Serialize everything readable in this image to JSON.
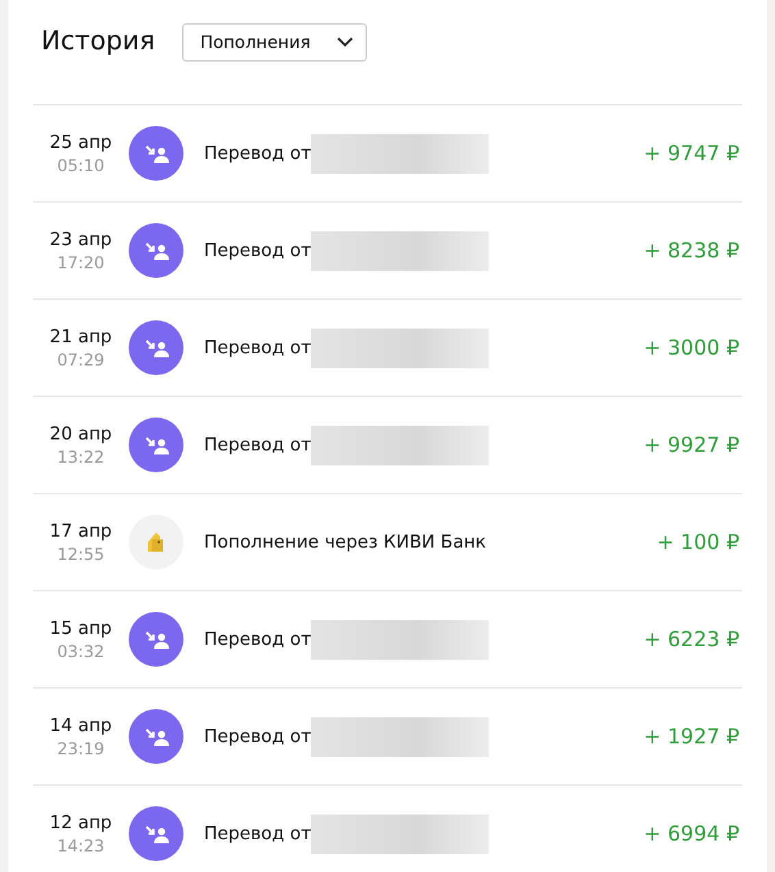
{
  "title": "История",
  "filter": {
    "value": "Пополнения"
  },
  "operations": [
    {
      "date": "25 апр",
      "time": "05:10",
      "kind": "transfer",
      "description": "Перевод от",
      "redacted": true,
      "amount": "+ 9747 ₽"
    },
    {
      "date": "23 апр",
      "time": "17:20",
      "kind": "transfer",
      "description": "Перевод от",
      "redacted": true,
      "amount": "+ 8238 ₽"
    },
    {
      "date": "21 апр",
      "time": "07:29",
      "kind": "transfer",
      "description": "Перевод от",
      "redacted": true,
      "amount": "+ 3000 ₽"
    },
    {
      "date": "20 апр",
      "time": "13:22",
      "kind": "transfer",
      "description": "Перевод от",
      "redacted": true,
      "amount": "+ 9927 ₽"
    },
    {
      "date": "17 апр",
      "time": "12:55",
      "kind": "topup",
      "description": "Пополнение через КИВИ Банк",
      "redacted": false,
      "amount": "+ 100 ₽"
    },
    {
      "date": "15 апр",
      "time": "03:32",
      "kind": "transfer",
      "description": "Перевод от",
      "redacted": true,
      "amount": "+ 6223 ₽"
    },
    {
      "date": "14 апр",
      "time": "23:19",
      "kind": "transfer",
      "description": "Перевод от",
      "redacted": true,
      "amount": "+ 1927 ₽"
    },
    {
      "date": "12 апр",
      "time": "14:23",
      "kind": "transfer",
      "description": "Перевод от",
      "redacted": true,
      "amount": "+ 6994 ₽"
    }
  ]
}
